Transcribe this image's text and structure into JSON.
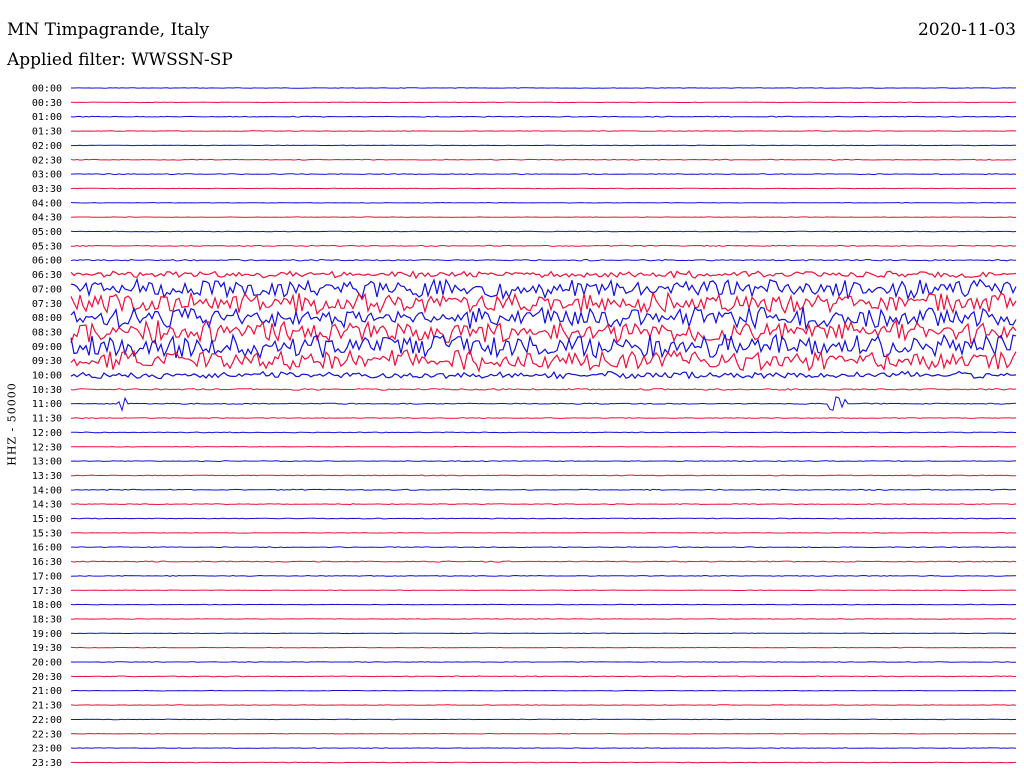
{
  "header": {
    "station": "MN Timpagrande, Italy",
    "date": "2020-11-03",
    "filter": "Applied filter: WWSSN-SP"
  },
  "chart_data": {
    "type": "line",
    "ylabel": "HHZ - 50000",
    "colors": [
      "#1010dd",
      "#ee1037"
    ],
    "time_labels": [
      "00:00",
      "00:30",
      "01:00",
      "01:30",
      "02:00",
      "02:30",
      "03:00",
      "03:30",
      "04:00",
      "04:30",
      "05:00",
      "05:30",
      "06:00",
      "06:30",
      "07:00",
      "07:30",
      "08:00",
      "08:30",
      "09:00",
      "09:30",
      "10:00",
      "10:30",
      "11:00",
      "11:30",
      "12:00",
      "12:30",
      "13:00",
      "13:30",
      "14:00",
      "14:30",
      "15:00",
      "15:30",
      "16:00",
      "16:30",
      "17:00",
      "17:30",
      "18:00",
      "18:30",
      "19:00",
      "19:30",
      "20:00",
      "20:30",
      "21:00",
      "21:30",
      "22:00",
      "22:30",
      "23:00",
      "23:30"
    ],
    "segments_per_trace": 30,
    "noise_level": [
      0.02,
      0.02,
      0.03,
      0.02,
      0.02,
      0.03,
      0.03,
      0.02,
      0.02,
      0.02,
      0.02,
      0.04,
      0.05,
      0.25,
      0.7,
      0.75,
      0.8,
      0.8,
      0.9,
      0.75,
      0.25,
      0.06,
      0.04,
      0.03,
      0.03,
      0.02,
      0.03,
      0.03,
      0.04,
      0.03,
      0.03,
      0.02,
      0.03,
      0.04,
      0.03,
      0.02,
      0.02,
      0.02,
      0.02,
      0.02,
      0.02,
      0.03,
      0.02,
      0.02,
      0.02,
      0.02,
      0.02,
      0.02
    ],
    "bursts": [
      {
        "trace": 16,
        "from": 0.15,
        "to": 0.46,
        "amp": 0.35
      },
      {
        "trace": 22,
        "from": 0.05,
        "to": 0.06,
        "amp": 0.5
      },
      {
        "trace": 22,
        "from": 0.8,
        "to": 0.82,
        "amp": 0.5
      }
    ]
  }
}
